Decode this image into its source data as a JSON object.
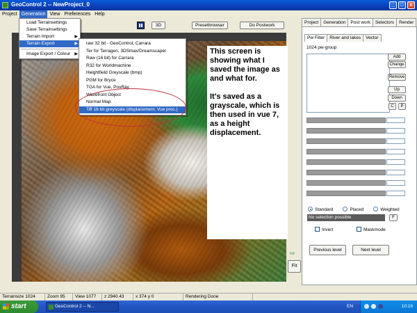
{
  "window": {
    "title": "GeoControl 2  --  NewProject_0",
    "controls": {
      "minimize": "_",
      "maximize": "□",
      "close": "x"
    }
  },
  "menubar": [
    "Project",
    "Generation",
    "View",
    "Preferences",
    "Help"
  ],
  "generation_menu": {
    "items": [
      "Load Terrainsettings",
      "Save Terrainsettings",
      "Terrain Import",
      "Terrain Export",
      "Image Export / Colour"
    ]
  },
  "terrain_export_menu": {
    "items": [
      "raw 32 bit - GeoControl, Carrara",
      "Ter for Terragen, 3DSmax/Dreamscaper",
      "Raw (16 bit) for Carrara",
      "R32 for Worldmachine",
      "Heightfield Greyscale (bmp)",
      "PGM for Bryce",
      "TGA for Vue, PovRay",
      "Wavefront Object",
      "Normal Map",
      "Tiff 16 bit greyscale (displacement, Vue proc.)"
    ]
  },
  "toolbar": {
    "btn_3d": "3D",
    "presetbrowser": "Presetbrowser",
    "postwork": "Do Postwork"
  },
  "note": {
    "p1": "This screen is showing what I saved the image as and what for.",
    "p2": "It's saved as a grayscale, which is then used in vue 7, as a height displacement."
  },
  "fit_button": "Fit",
  "right_panel": {
    "tabs": [
      "Project",
      "Generation",
      "Post work",
      "Selectors",
      "Render"
    ],
    "active_tab": "Post work",
    "subtabs": [
      "Pw Filter",
      "River and lakes",
      "Vector"
    ],
    "group_label": "1024 pw-group",
    "buttons": {
      "add": "Add",
      "change": "Change",
      "remove": "Remove",
      "up": "Up",
      "down": "Down",
      "c": "C",
      "p": "P"
    },
    "radios": [
      "Standard",
      "Placed",
      "Weighted"
    ],
    "selection_text": "No selection possible",
    "f_button": "F",
    "checks": [
      "Invert",
      "Maskmode"
    ],
    "prev_level": "Previous level",
    "next_level": "Next level"
  },
  "statusbar": {
    "terrainsize": "Terrainsize  1024",
    "zoom": "Zoom  95",
    "view": "View  1077",
    "z": "z 2940.43",
    "xy": "x 374 y 0",
    "status": "Rendering Done"
  },
  "taskbar": {
    "start": "start",
    "task": "GeoControl 2  --  N...",
    "lang": "EN",
    "time": "10:16"
  }
}
